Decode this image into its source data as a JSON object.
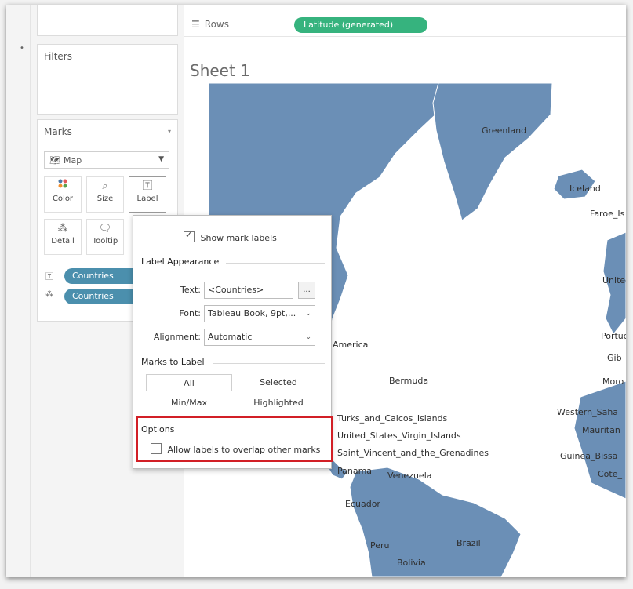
{
  "shelves": {
    "rows_label": "Rows",
    "rows_pill": "Latitude (generated)"
  },
  "filters": {
    "title": "Filters"
  },
  "marks": {
    "title": "Marks",
    "mark_type": "Map",
    "buttons": [
      {
        "label": "Color",
        "icon": "color-dots-icon"
      },
      {
        "label": "Size",
        "icon": "size-icon"
      },
      {
        "label": "Label",
        "icon": "label-icon"
      },
      {
        "label": "Detail",
        "icon": "detail-icon"
      },
      {
        "label": "Tooltip",
        "icon": "tooltip-icon"
      }
    ],
    "pills": [
      {
        "label": "Countries",
        "icon": "label-icon"
      },
      {
        "label": "Countries",
        "icon": "detail-icon"
      }
    ]
  },
  "sheet": {
    "title": "Sheet 1"
  },
  "map": {
    "land_color": "#6b8fb6",
    "labels": [
      "Greenland",
      "Iceland",
      "Faroe_Is",
      "United",
      "America",
      "Portug",
      "Gib",
      "Moro",
      "Bermuda",
      "Western_Saha",
      "Mauritan",
      "Guinea_Bissa",
      "Cote_",
      "Turks_and_Caicos_Islands",
      "United_States_Virgin_Islands",
      "Saint_Vincent_and_the_Grenadines",
      "Panama",
      "Venezuela",
      "Ecuador",
      "Peru",
      "Brazil",
      "Bolivia"
    ]
  },
  "label_popup": {
    "show_mark_labels": "Show mark labels",
    "show_mark_labels_checked": true,
    "appearance_title": "Label Appearance",
    "text_label": "Text:",
    "text_value": "<Countries>",
    "ellipsis": "...",
    "font_label": "Font:",
    "font_value": "Tableau Book, 9pt,...",
    "alignment_label": "Alignment:",
    "alignment_value": "Automatic",
    "marks_to_label_title": "Marks to Label",
    "options": [
      "All",
      "Selected",
      "Min/Max",
      "Highlighted"
    ],
    "selected_option": "All",
    "options_title": "Options",
    "allow_overlap": "Allow labels to overlap other marks",
    "allow_overlap_checked": false,
    "highlight_color": "#d21f26"
  }
}
